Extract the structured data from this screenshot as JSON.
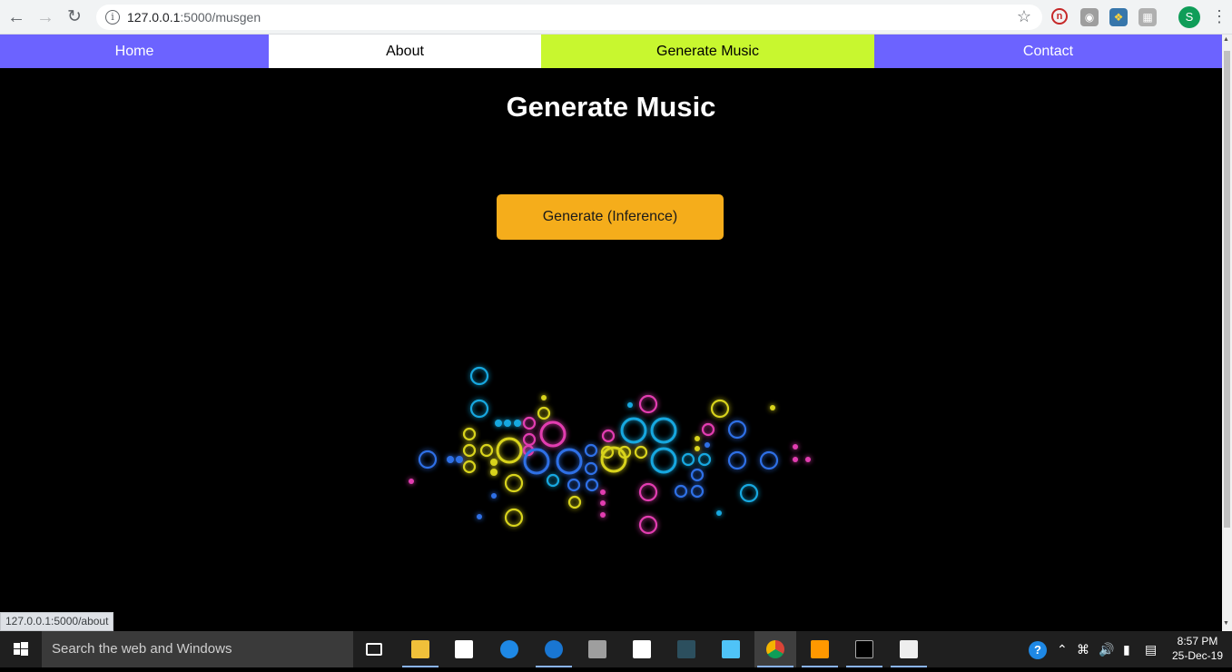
{
  "browser": {
    "back_icon": "arrow-left-icon",
    "forward_icon": "arrow-right-icon",
    "reload_icon": "reload-icon",
    "url_host": "127.0.0.1",
    "url_path": ":5000/musgen",
    "profile_initial": "S"
  },
  "nav": {
    "home": "Home",
    "about": "About",
    "generate": "Generate Music",
    "contact": "Contact",
    "colors": {
      "primary": "#6c63ff",
      "active": "#c8f72f"
    }
  },
  "main": {
    "title": "Generate Music",
    "generate_button": "Generate (Inference)",
    "button_color": "#f5ad1b"
  },
  "status_bar": {
    "hover_url": "127.0.0.1:5000/about"
  },
  "taskbar": {
    "search_placeholder": "Search the web and Windows",
    "time": "8:57 PM",
    "date": "25-Dec-19"
  }
}
